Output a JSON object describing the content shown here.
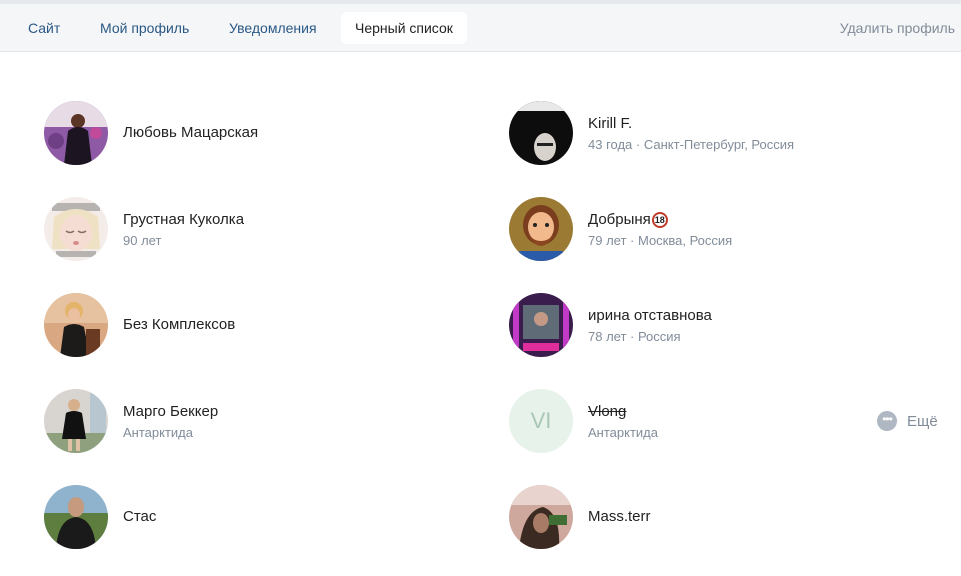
{
  "tabs": {
    "items": [
      {
        "label": "Сайт"
      },
      {
        "label": "Мой профиль"
      },
      {
        "label": "Уведомления"
      },
      {
        "label": "Черный список"
      }
    ],
    "delete_profile": "Удалить профиль"
  },
  "blacklist": {
    "left": [
      {
        "name": "Любовь Мацарская",
        "meta": ""
      },
      {
        "name": "Грустная Куколка",
        "meta": "90 лет"
      },
      {
        "name": "Без Комплексов",
        "meta": ""
      },
      {
        "name": "Марго Беккер",
        "meta": "Антарктида"
      },
      {
        "name": "Стас",
        "meta": ""
      }
    ],
    "right": [
      {
        "name": "Kirill F.",
        "meta": "43 года · Санкт-Петербург, Россия"
      },
      {
        "name": "Добрыня",
        "badge": "18",
        "meta": "79 лет · Москва, Россия"
      },
      {
        "name": "ирина отставнова",
        "meta": "78 лет · Россия"
      },
      {
        "name": "Vlong",
        "initials": "VI",
        "meta": "Антарктида"
      },
      {
        "name": "Mass.terr",
        "meta": ""
      }
    ]
  },
  "more": {
    "label": "Ещё"
  },
  "colors": {
    "link": "#2a5885",
    "muted": "#818c99",
    "tab_bg": "#f5f6f8"
  }
}
